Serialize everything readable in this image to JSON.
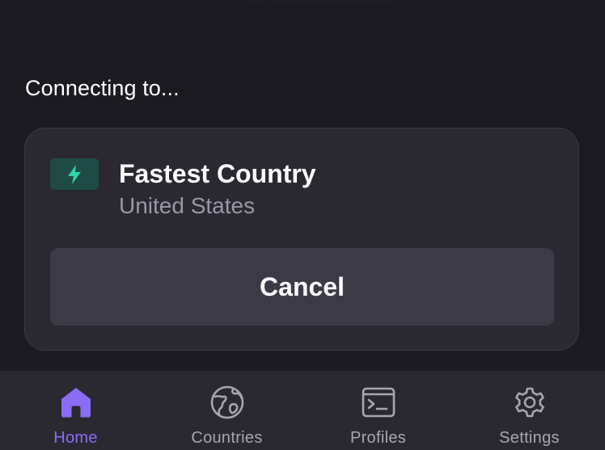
{
  "status": {
    "label": "Connecting to..."
  },
  "server": {
    "icon": "lightning-icon",
    "title": "Fastest Country",
    "subtitle": "United States",
    "badge_color": "#1f4a45",
    "icon_color": "#2ed3a6"
  },
  "actions": {
    "cancel_label": "Cancel"
  },
  "tabs": [
    {
      "label": "Home",
      "icon": "home-icon",
      "active": true
    },
    {
      "label": "Countries",
      "icon": "globe-icon",
      "active": false
    },
    {
      "label": "Profiles",
      "icon": "terminal-icon",
      "active": false
    },
    {
      "label": "Settings",
      "icon": "gear-icon",
      "active": false
    }
  ],
  "colors": {
    "background": "#1c1b22",
    "card": "#2a2831",
    "accent": "#8b6cf5",
    "inactive": "#a8a5b3"
  }
}
